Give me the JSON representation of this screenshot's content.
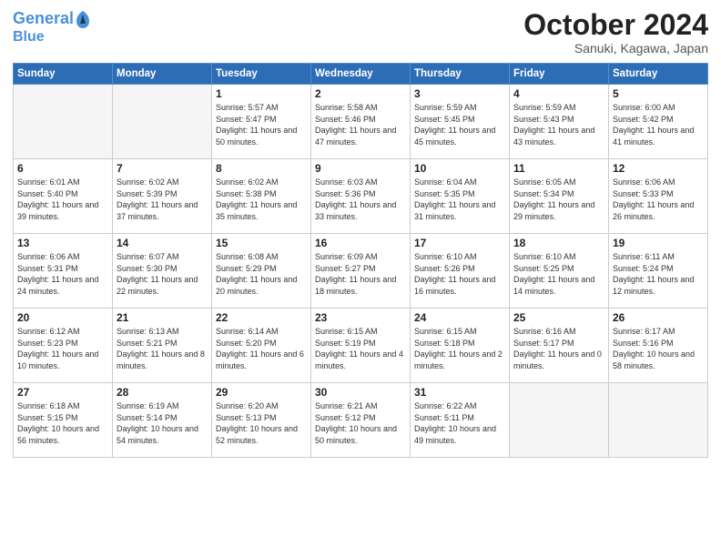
{
  "header": {
    "logo_line1": "General",
    "logo_line2": "Blue",
    "month": "October 2024",
    "location": "Sanuki, Kagawa, Japan"
  },
  "weekdays": [
    "Sunday",
    "Monday",
    "Tuesday",
    "Wednesday",
    "Thursday",
    "Friday",
    "Saturday"
  ],
  "weeks": [
    [
      {
        "day": "",
        "info": ""
      },
      {
        "day": "",
        "info": ""
      },
      {
        "day": "1",
        "info": "Sunrise: 5:57 AM\nSunset: 5:47 PM\nDaylight: 11 hours and 50 minutes."
      },
      {
        "day": "2",
        "info": "Sunrise: 5:58 AM\nSunset: 5:46 PM\nDaylight: 11 hours and 47 minutes."
      },
      {
        "day": "3",
        "info": "Sunrise: 5:59 AM\nSunset: 5:45 PM\nDaylight: 11 hours and 45 minutes."
      },
      {
        "day": "4",
        "info": "Sunrise: 5:59 AM\nSunset: 5:43 PM\nDaylight: 11 hours and 43 minutes."
      },
      {
        "day": "5",
        "info": "Sunrise: 6:00 AM\nSunset: 5:42 PM\nDaylight: 11 hours and 41 minutes."
      }
    ],
    [
      {
        "day": "6",
        "info": "Sunrise: 6:01 AM\nSunset: 5:40 PM\nDaylight: 11 hours and 39 minutes."
      },
      {
        "day": "7",
        "info": "Sunrise: 6:02 AM\nSunset: 5:39 PM\nDaylight: 11 hours and 37 minutes."
      },
      {
        "day": "8",
        "info": "Sunrise: 6:02 AM\nSunset: 5:38 PM\nDaylight: 11 hours and 35 minutes."
      },
      {
        "day": "9",
        "info": "Sunrise: 6:03 AM\nSunset: 5:36 PM\nDaylight: 11 hours and 33 minutes."
      },
      {
        "day": "10",
        "info": "Sunrise: 6:04 AM\nSunset: 5:35 PM\nDaylight: 11 hours and 31 minutes."
      },
      {
        "day": "11",
        "info": "Sunrise: 6:05 AM\nSunset: 5:34 PM\nDaylight: 11 hours and 29 minutes."
      },
      {
        "day": "12",
        "info": "Sunrise: 6:06 AM\nSunset: 5:33 PM\nDaylight: 11 hours and 26 minutes."
      }
    ],
    [
      {
        "day": "13",
        "info": "Sunrise: 6:06 AM\nSunset: 5:31 PM\nDaylight: 11 hours and 24 minutes."
      },
      {
        "day": "14",
        "info": "Sunrise: 6:07 AM\nSunset: 5:30 PM\nDaylight: 11 hours and 22 minutes."
      },
      {
        "day": "15",
        "info": "Sunrise: 6:08 AM\nSunset: 5:29 PM\nDaylight: 11 hours and 20 minutes."
      },
      {
        "day": "16",
        "info": "Sunrise: 6:09 AM\nSunset: 5:27 PM\nDaylight: 11 hours and 18 minutes."
      },
      {
        "day": "17",
        "info": "Sunrise: 6:10 AM\nSunset: 5:26 PM\nDaylight: 11 hours and 16 minutes."
      },
      {
        "day": "18",
        "info": "Sunrise: 6:10 AM\nSunset: 5:25 PM\nDaylight: 11 hours and 14 minutes."
      },
      {
        "day": "19",
        "info": "Sunrise: 6:11 AM\nSunset: 5:24 PM\nDaylight: 11 hours and 12 minutes."
      }
    ],
    [
      {
        "day": "20",
        "info": "Sunrise: 6:12 AM\nSunset: 5:23 PM\nDaylight: 11 hours and 10 minutes."
      },
      {
        "day": "21",
        "info": "Sunrise: 6:13 AM\nSunset: 5:21 PM\nDaylight: 11 hours and 8 minutes."
      },
      {
        "day": "22",
        "info": "Sunrise: 6:14 AM\nSunset: 5:20 PM\nDaylight: 11 hours and 6 minutes."
      },
      {
        "day": "23",
        "info": "Sunrise: 6:15 AM\nSunset: 5:19 PM\nDaylight: 11 hours and 4 minutes."
      },
      {
        "day": "24",
        "info": "Sunrise: 6:15 AM\nSunset: 5:18 PM\nDaylight: 11 hours and 2 minutes."
      },
      {
        "day": "25",
        "info": "Sunrise: 6:16 AM\nSunset: 5:17 PM\nDaylight: 11 hours and 0 minutes."
      },
      {
        "day": "26",
        "info": "Sunrise: 6:17 AM\nSunset: 5:16 PM\nDaylight: 10 hours and 58 minutes."
      }
    ],
    [
      {
        "day": "27",
        "info": "Sunrise: 6:18 AM\nSunset: 5:15 PM\nDaylight: 10 hours and 56 minutes."
      },
      {
        "day": "28",
        "info": "Sunrise: 6:19 AM\nSunset: 5:14 PM\nDaylight: 10 hours and 54 minutes."
      },
      {
        "day": "29",
        "info": "Sunrise: 6:20 AM\nSunset: 5:13 PM\nDaylight: 10 hours and 52 minutes."
      },
      {
        "day": "30",
        "info": "Sunrise: 6:21 AM\nSunset: 5:12 PM\nDaylight: 10 hours and 50 minutes."
      },
      {
        "day": "31",
        "info": "Sunrise: 6:22 AM\nSunset: 5:11 PM\nDaylight: 10 hours and 49 minutes."
      },
      {
        "day": "",
        "info": ""
      },
      {
        "day": "",
        "info": ""
      }
    ]
  ]
}
